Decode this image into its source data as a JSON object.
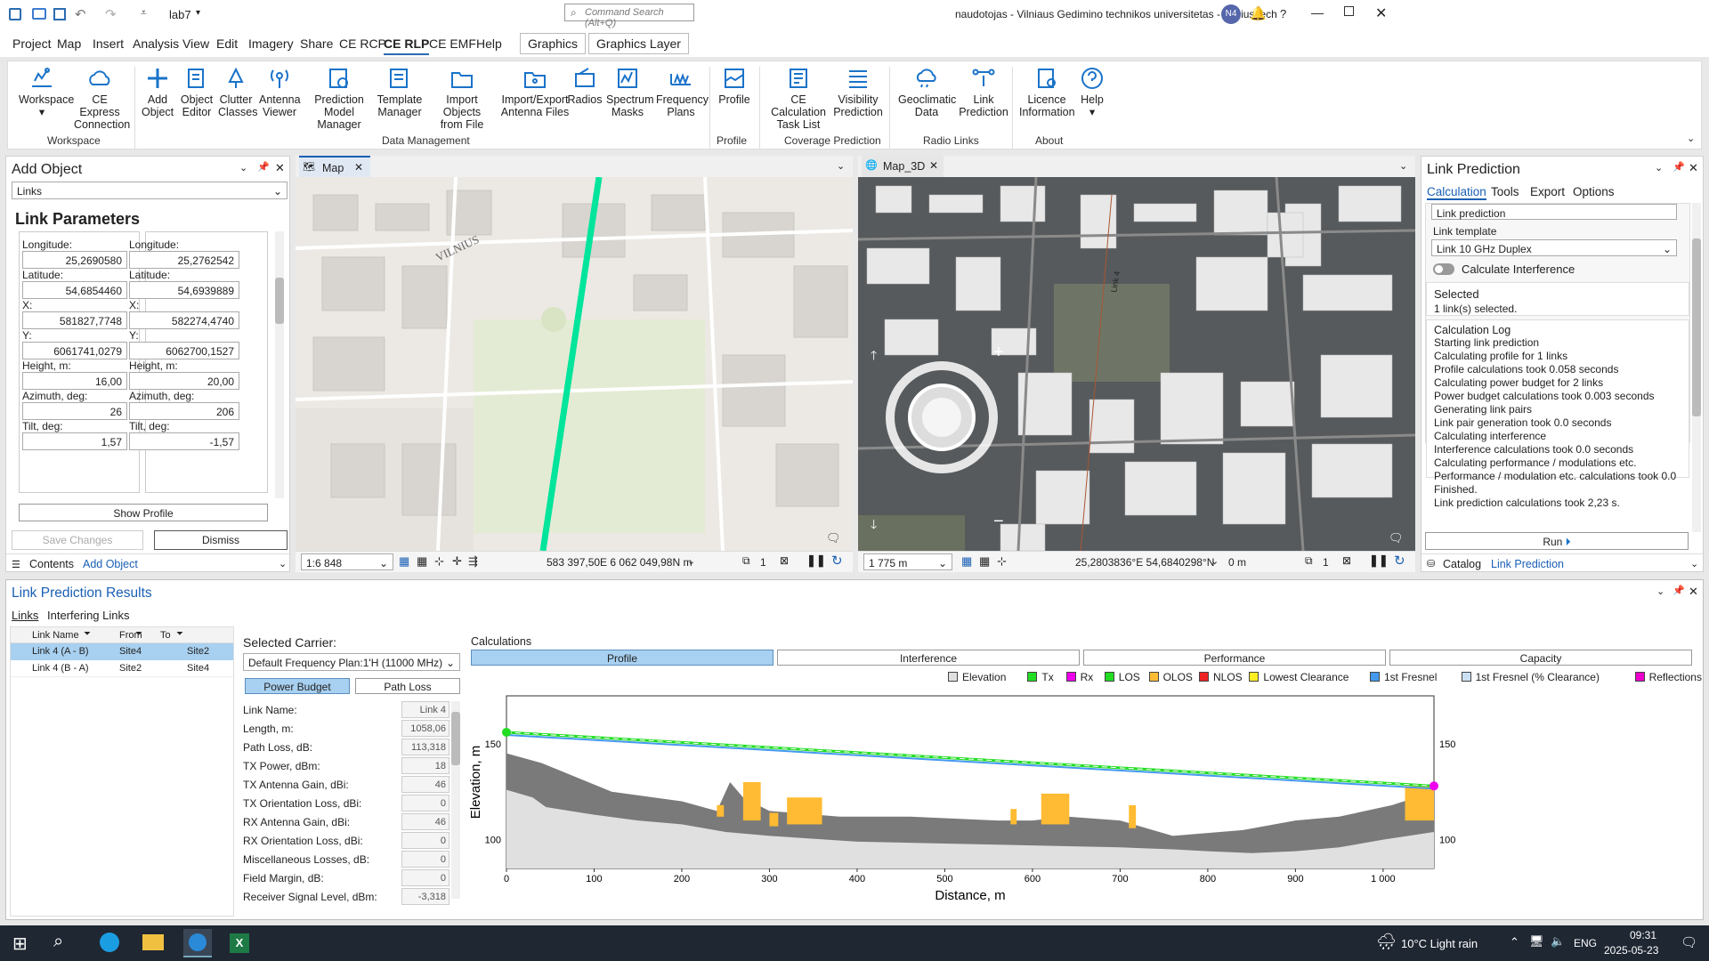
{
  "titlebar": {
    "file": "lab7",
    "search_placeholder": "Command Search (Alt+Q)",
    "user": "naudotojas - Vilniaus Gedimino technikos universitetas - VilniusTech",
    "initials": "N4"
  },
  "menu": [
    "Project",
    "Map",
    "Insert",
    "Analysis",
    "View",
    "Edit",
    "Imagery",
    "Share",
    "CE RCP",
    "CE RLP",
    "CE EMF",
    "Help"
  ],
  "menu_contextual": [
    "Graphics",
    "Graphics Layer"
  ],
  "ribbon": {
    "buttons": [
      {
        "l1": "Workspace",
        "l2": ""
      },
      {
        "l1": "CE Express",
        "l2": "Connection"
      },
      {
        "l1": "Add",
        "l2": "Object"
      },
      {
        "l1": "Object",
        "l2": "Editor"
      },
      {
        "l1": "Clutter",
        "l2": "Classes"
      },
      {
        "l1": "Antenna",
        "l2": "Viewer"
      },
      {
        "l1": "Prediction",
        "l2": "Model Manager"
      },
      {
        "l1": "Template",
        "l2": "Manager"
      },
      {
        "l1": "Import Objects",
        "l2": "from File"
      },
      {
        "l1": "Import/Export",
        "l2": "Antenna Files"
      },
      {
        "l1": "Radios",
        "l2": ""
      },
      {
        "l1": "Spectrum",
        "l2": "Masks"
      },
      {
        "l1": "Frequency",
        "l2": "Plans"
      },
      {
        "l1": "Profile",
        "l2": ""
      },
      {
        "l1": "CE Calculation",
        "l2": "Task List"
      },
      {
        "l1": "Visibility",
        "l2": "Prediction"
      },
      {
        "l1": "Geoclimatic",
        "l2": "Data"
      },
      {
        "l1": "Link",
        "l2": "Prediction"
      },
      {
        "l1": "Licence",
        "l2": "Information"
      },
      {
        "l1": "Help",
        "l2": ""
      }
    ],
    "groups": [
      "Workspace",
      "Data Management",
      "Profile",
      "Coverage Prediction",
      "Radio Links",
      "About"
    ]
  },
  "add_object": {
    "title": "Add Object",
    "type": "Links",
    "heading": "Link Parameters",
    "left": {
      "lon_l": "Longitude:",
      "lon": "25,2690580",
      "lat_l": "Latitude:",
      "lat": "54,6854460",
      "x_l": "X:",
      "x": "581827,7748",
      "y_l": "Y:",
      "y": "6061741,0279",
      "h_l": "Height, m:",
      "h": "16,00",
      "az_l": "Azimuth, deg:",
      "az": "26",
      "tilt_l": "Tilt, deg:",
      "tilt": "1,57"
    },
    "right": {
      "lon_l": "Longitude:",
      "lon": "25,2762542",
      "lat_l": "Latitude:",
      "lat": "54,6939889",
      "x_l": "X:",
      "x": "582274,4740",
      "y_l": "Y:",
      "y": "6062700,1527",
      "h_l": "Height, m:",
      "h": "20,00",
      "az_l": "Azimuth, deg:",
      "az": "206",
      "tilt_l": "Tilt, deg:",
      "tilt": "-1,57"
    },
    "show_profile": "Show Profile",
    "save": "Save Changes",
    "dismiss": "Dismiss",
    "tab_contents": "Contents",
    "tab_add": "Add Object"
  },
  "map": {
    "tab": "Map",
    "scale": "1:6 848",
    "coords": "583 397,50E 6 062 049,98N m",
    "sel": "1",
    "label": "VILNIUS"
  },
  "map3d": {
    "tab": "Map_3D",
    "scale": "1 775 m",
    "coords": "25,2803836°E 54,6840298°N",
    "elev": "0 m",
    "sel": "1",
    "road": "Link 4"
  },
  "link_pred": {
    "title": "Link Prediction",
    "tabs": [
      "Calculation",
      "Tools",
      "Export",
      "Options"
    ],
    "name": "Link prediction",
    "template_l": "Link template",
    "template": "Link 10 GHz Duplex",
    "interference": "Calculate Interference",
    "selected_h": "Selected",
    "selected": "1 link(s) selected.",
    "log_h": "Calculation Log",
    "log": [
      "Starting link prediction",
      "Calculating profile for 1 links",
      "Profile calculations took 0.058 seconds",
      "Calculating power budget for 2 links",
      "Power budget calculations took 0.003 seconds",
      "Generating link pairs",
      "Link pair generation took 0.0 seconds",
      "Calculating interference",
      "Interference calculations took 0.0 seconds",
      "Calculating performance / modulations etc.",
      "Performance / modulation etc. calculations took 0.0",
      "Finished.",
      "Link prediction calculations took 2,23 s."
    ],
    "run": "Run",
    "tab_catalog": "Catalog",
    "tab_lp": "Link Prediction"
  },
  "results": {
    "title": "Link Prediction Results",
    "tabs": [
      "Links",
      "Interfering Links"
    ],
    "cols": [
      "Link Name",
      "From",
      "To"
    ],
    "rows": [
      [
        "Link 4 (A - B)",
        "Site4",
        "Site2"
      ],
      [
        "Link 4 (B - A)",
        "Site2",
        "Site4"
      ]
    ],
    "carrier_l": "Selected Carrier:",
    "carrier": "Default Frequency Plan:1'H (11000 MHz)",
    "pb": "Power Budget",
    "pl": "Path Loss",
    "budget": [
      [
        "Link Name:",
        "Link 4"
      ],
      [
        "Length, m:",
        "1058,06"
      ],
      [
        "Path Loss, dB:",
        "113,318"
      ],
      [
        "TX Power, dBm:",
        "18"
      ],
      [
        "TX Antenna Gain, dBi:",
        "46"
      ],
      [
        "TX Orientation Loss, dBi:",
        "0"
      ],
      [
        "RX Antenna Gain, dBi:",
        "46"
      ],
      [
        "RX Orientation Loss, dBi:",
        "0"
      ],
      [
        "Miscellaneous Losses, dB:",
        "0"
      ],
      [
        "Field Margin, dB:",
        "0"
      ],
      [
        "Receiver Signal Level, dBm:",
        "-3,318"
      ]
    ],
    "calc_l": "Calculations",
    "calc_tabs": [
      "Profile",
      "Interference",
      "Performance",
      "Capacity"
    ],
    "legend": [
      {
        "n": "Elevation",
        "c": "#e0e0e0"
      },
      {
        "n": "Tx",
        "c": "#22dd22"
      },
      {
        "n": "Rx",
        "c": "#ee00ee"
      },
      {
        "n": "LOS",
        "c": "#22dd22"
      },
      {
        "n": "OLOS",
        "c": "#ffbb33"
      },
      {
        "n": "NLOS",
        "c": "#ee2222"
      },
      {
        "n": "Lowest Clearance",
        "c": "#ffee22"
      },
      {
        "n": "1st Fresnel",
        "c": "#4499ee"
      },
      {
        "n": "1st Fresnel (% Clearance)",
        "c": "#cce0f5"
      },
      {
        "n": "Reflections",
        "c": "#ee00cc"
      }
    ]
  },
  "chart_data": {
    "type": "area",
    "xlabel": "Distance, m",
    "ylabel": "Elevation, m",
    "xlim": [
      0,
      1058
    ],
    "ylim": [
      85,
      175
    ],
    "xticks": [
      "0",
      "100",
      "200",
      "300",
      "400",
      "500",
      "600",
      "700",
      "800",
      "900",
      "1 000"
    ],
    "yticks": [
      "100",
      "150"
    ],
    "tx": {
      "x": 0,
      "y": 156
    },
    "rx": {
      "x": 1058,
      "y": 128
    },
    "terrain": [
      [
        0,
        126
      ],
      [
        30,
        122
      ],
      [
        45,
        117
      ],
      [
        100,
        113
      ],
      [
        150,
        110
      ],
      [
        200,
        108
      ],
      [
        250,
        104
      ],
      [
        300,
        102
      ],
      [
        400,
        99
      ],
      [
        500,
        98
      ],
      [
        600,
        97
      ],
      [
        700,
        96
      ],
      [
        760,
        95
      ],
      [
        800,
        94
      ],
      [
        850,
        93
      ],
      [
        900,
        94
      ],
      [
        950,
        96
      ],
      [
        1000,
        100
      ],
      [
        1058,
        104
      ]
    ],
    "buildings": [
      [
        0,
        145
      ],
      [
        40,
        140
      ],
      [
        120,
        125
      ],
      [
        200,
        120
      ],
      [
        240,
        115
      ],
      [
        255,
        130
      ],
      [
        270,
        122
      ],
      [
        300,
        115
      ],
      [
        380,
        112
      ],
      [
        460,
        112
      ],
      [
        560,
        110
      ],
      [
        600,
        110
      ],
      [
        640,
        112
      ],
      [
        700,
        110
      ],
      [
        760,
        102
      ],
      [
        840,
        105
      ],
      [
        900,
        110
      ],
      [
        950,
        112
      ],
      [
        1010,
        118
      ],
      [
        1058,
        125
      ]
    ],
    "olos": [
      [
        240,
        248,
        112,
        118
      ],
      [
        270,
        290,
        110,
        130
      ],
      [
        300,
        310,
        107,
        114
      ],
      [
        320,
        360,
        108,
        122
      ],
      [
        575,
        582,
        108,
        116
      ],
      [
        610,
        642,
        108,
        124
      ],
      [
        710,
        718,
        106,
        118
      ],
      [
        1025,
        1058,
        110,
        128
      ]
    ]
  },
  "taskbar": {
    "weather": "10°C  Light rain",
    "lang": "ENG",
    "time": "09:31",
    "date": "2025-05-23"
  }
}
